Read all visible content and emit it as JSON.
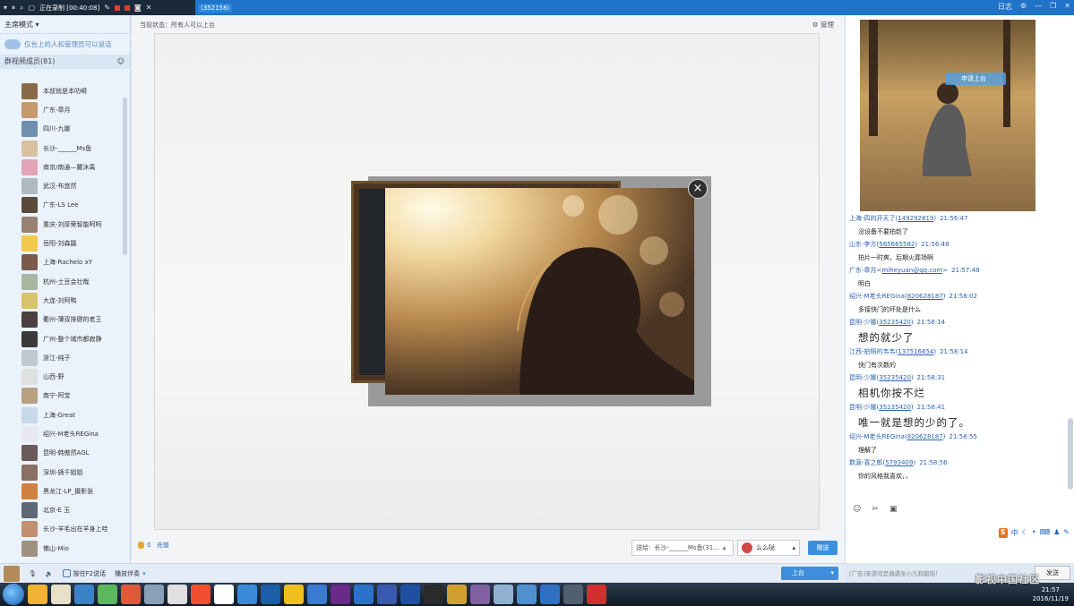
{
  "recorder": {
    "status": "正在录制 [00:40:08]",
    "room_id": "(352158)"
  },
  "titlebar": {
    "right_label": "日志"
  },
  "left": {
    "mode": "主席模式",
    "notice": "仅台上的人和管理员可以说话",
    "members_title": "群视频成员(81)",
    "members": [
      "本叔就是本叻嗬",
      "广东-章月",
      "四川-九娜",
      "长沙-______Ms鱼",
      "南京/南通—麓沐禹",
      "武汉-布悠然",
      "广东-LS Lee",
      "重庆-刘厚荣智能呵呵",
      "岳阳-刘森鼷",
      "上海-Rachelo xY",
      "杭州-土豆会壮哉",
      "大连-刘阿鸭",
      "衢州-薄双排健的老王",
      "广州-整个城市都寂静",
      "浙江-纯子",
      "山西-野",
      "南宁-阿宝",
      "上海-Great",
      "绍兴-M老头REGina",
      "昆明-韩傲然AGL",
      "深圳-旖千姐姐",
      "黑龙江-LP_摄影张",
      "北京-E 玉",
      "长沙-羊毛出在羊身上哇",
      "佛山-Mio"
    ]
  },
  "center": {
    "status": "当前状态：所有人可以上台",
    "manage": "管理",
    "flowers": {
      "count": "0",
      "label": "充值"
    },
    "send_to_label": "送给:",
    "send_to_value": "长沙-______Ms鱼(31...",
    "gift": "么么哒",
    "give_button": "赠送"
  },
  "right": {
    "on_stage_badge": "申请上台",
    "messages": [
      {
        "name": "上海-四的开天了(",
        "qq": "149292819",
        "tail": ")",
        "time": "21:56:47",
        "text": "没设备不要拍趁了",
        "big": false
      },
      {
        "name": "山东-李方(",
        "qq": "565665582",
        "tail": ")",
        "time": "21:56:48",
        "text": "拍片一时爽，后期火葬场啊",
        "big": false
      },
      {
        "name": "广东-章月<",
        "qq": "miheyuan@qq.com",
        "tail": ">",
        "time": "21:57:48",
        "text": "明白",
        "big": false
      },
      {
        "name": "绍兴-M老头REGina(",
        "qq": "820628187",
        "tail": ")",
        "time": "21:58:02",
        "text": "多接快门的坏处是什么",
        "big": false
      },
      {
        "name": "昆明-少娜(",
        "qq": "35235420",
        "tail": ")",
        "time": "21:58:14",
        "text": "想的就少了",
        "big": true
      },
      {
        "name": "江西-拍照的韦韦(",
        "qq": "137516654",
        "tail": ")",
        "time": "21:58:14",
        "text": "快门有次数的",
        "big": false
      },
      {
        "name": "昆明-少娜(",
        "qq": "35235420",
        "tail": ")",
        "time": "21:58:31",
        "text": "相机你按不烂",
        "big": true
      },
      {
        "name": "昆明-少娜(",
        "qq": "35235420",
        "tail": ")",
        "time": "21:58:41",
        "text": "唯一就是想的少的了。",
        "big": true
      },
      {
        "name": "绍兴-M老头REGina(",
        "qq": "820628187",
        "tail": ")",
        "time": "21:58:55",
        "text": "理解了",
        "big": false
      },
      {
        "name": "数源-喜之郎(",
        "qq": "5793409",
        "tail": ")",
        "time": "21:58:56",
        "text": "你的风格我喜欢，，",
        "big": false
      }
    ],
    "ime_label": "中",
    "ad": "[广告]来游戏是偶遇张小凡和碧瑶！",
    "send_button": "发送"
  },
  "bottom": {
    "f2_label": "按住F2说话",
    "queue_label": "播放伴奏",
    "stage_button": "上台"
  },
  "taskbar": {
    "time": "21:57",
    "date": "2016/11/19",
    "watermark": "影视中国社区"
  }
}
